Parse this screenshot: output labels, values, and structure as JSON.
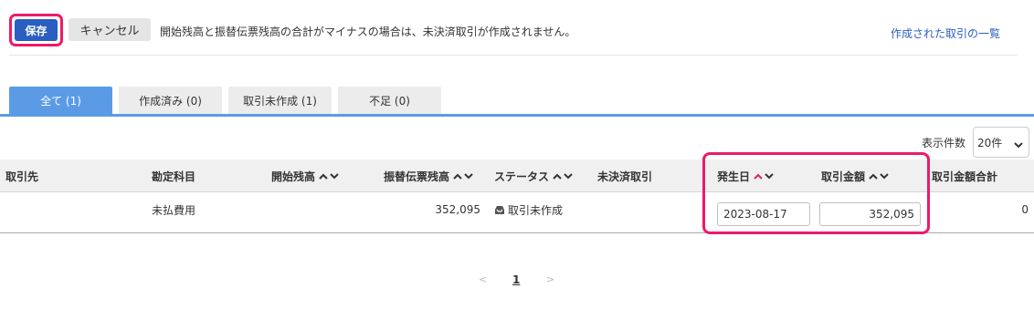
{
  "toolbar": {
    "save_label": "保存",
    "cancel_label": "キャンセル",
    "notice": "開始残高と振替伝票残高の合計がマイナスの場合は、未決済取引が作成されません。",
    "list_link": "作成された取引の一覧"
  },
  "tabs": [
    {
      "label": "全て (1)",
      "active": true
    },
    {
      "label": "作成済み (0)",
      "active": false
    },
    {
      "label": "取引未作成 (1)",
      "active": false
    },
    {
      "label": "不足 (0)",
      "active": false
    }
  ],
  "page_size": {
    "label": "表示件数",
    "value": "20件"
  },
  "table": {
    "headers": {
      "partner": "取引先",
      "account": "勘定科目",
      "opening": "開始残高",
      "transfer": "振替伝票残高",
      "status": "ステータス",
      "unsettled": "未決済取引",
      "date": "発生日",
      "amount": "取引金額",
      "total": "取引金額合計"
    },
    "rows": [
      {
        "partner": "",
        "account": "未払費用",
        "opening": "",
        "transfer": "352,095",
        "status": "取引未作成",
        "unsettled": "",
        "date": "2023-08-17",
        "amount": "352,095",
        "total": "0"
      }
    ]
  },
  "pagination": {
    "prev": "<",
    "current": "1",
    "next": ">"
  },
  "colors": {
    "primary": "#2a5ec0",
    "tab_active": "#5b9be6",
    "highlight": "#ec1a6a",
    "sort_active": "#e0245e"
  },
  "icons": {
    "status": "inbox-icon",
    "sort": "chevron-up-down-icon",
    "select": "chevron-down-icon"
  }
}
